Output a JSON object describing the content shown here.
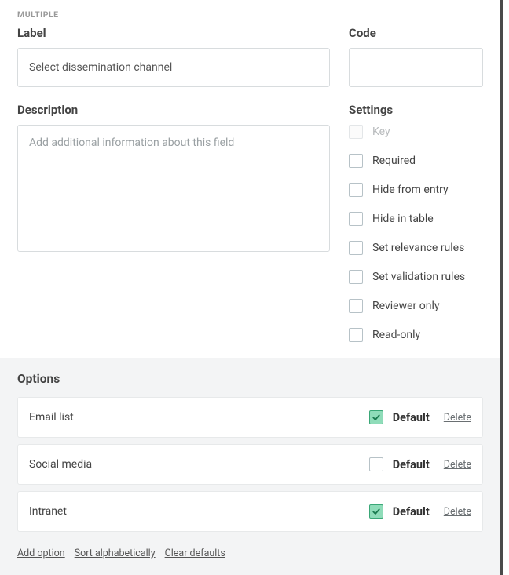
{
  "badge": "MULTIPLE",
  "label": {
    "title": "Label",
    "value": "Select dissemination channel"
  },
  "code": {
    "title": "Code",
    "value": ""
  },
  "description": {
    "title": "Description",
    "placeholder": "Add additional information about this field"
  },
  "settings": {
    "title": "Settings",
    "items": [
      {
        "label": "Key",
        "disabled": true
      },
      {
        "label": "Required",
        "disabled": false
      },
      {
        "label": "Hide from entry",
        "disabled": false
      },
      {
        "label": "Hide in table",
        "disabled": false
      },
      {
        "label": "Set relevance rules",
        "disabled": false
      },
      {
        "label": "Set validation rules",
        "disabled": false
      },
      {
        "label": "Reviewer only",
        "disabled": false
      },
      {
        "label": "Read-only",
        "disabled": false
      }
    ]
  },
  "options": {
    "title": "Options",
    "default_label": "Default",
    "delete_label": "Delete",
    "items": [
      {
        "label": "Email list",
        "default": true
      },
      {
        "label": "Social media",
        "default": false
      },
      {
        "label": "Intranet",
        "default": true
      }
    ],
    "actions": {
      "add": "Add option",
      "sort": "Sort alphabetically",
      "clear": "Clear defaults"
    }
  }
}
